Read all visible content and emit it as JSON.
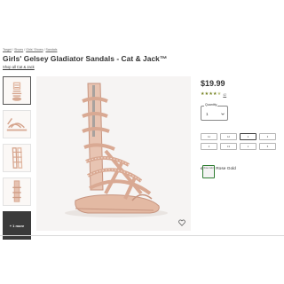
{
  "breadcrumb": [
    "Target",
    "Shoes",
    "Girls' Shoes",
    "Sandals"
  ],
  "product": {
    "title": "Girls' Gelsey Gladiator Sandals - Cat & Jack™",
    "brand_link": "Shop all Cat & Jack",
    "price": "$19.99",
    "rating": {
      "stars": 4.5,
      "count": "42"
    }
  },
  "thumbnails": {
    "more_label": "+ 1 more",
    "active_index": 0
  },
  "quantity": {
    "label": "Quantity",
    "value": "1"
  },
  "size": {
    "heading": "size",
    "value": "2",
    "chart_link": "Size chart",
    "options": [
      "11",
      "12",
      "2",
      "3",
      "4",
      "13",
      "1",
      "5"
    ],
    "selected": "2"
  },
  "color": {
    "heading": "color",
    "value": "Rose Gold",
    "swatch_label": "Rose Gold"
  },
  "colors": {
    "star": "#73801e",
    "sandal": "#e3b9a3",
    "sandal_dark": "#c79580",
    "link": "#3366cc",
    "selected_border": "#2f7d32"
  }
}
